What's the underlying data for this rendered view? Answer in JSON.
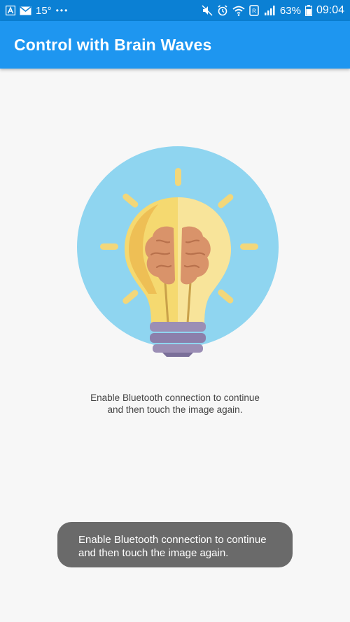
{
  "status_bar": {
    "temperature": "15°",
    "more": "•••",
    "battery": "63%",
    "time": "09:04",
    "left_icons": [
      "app-a-icon",
      "mail-icon"
    ],
    "right_icons": [
      "mute-icon",
      "alarm-icon",
      "wifi-icon",
      "data-saver-icon",
      "signal-icon",
      "battery-icon"
    ]
  },
  "app_bar": {
    "title": "Control with Brain Waves"
  },
  "hero": {
    "icon": "lightbulb-brain-icon",
    "colors": {
      "circle": "#8fd5f0",
      "bulb": "#f5d970",
      "base": "#9b8eb5",
      "brain": "#d9936a"
    }
  },
  "message": {
    "line1": "Enable Bluetooth connection to continue",
    "line2": "and then touch the image again."
  },
  "toast": {
    "line1": "Enable Bluetooth connection to continue",
    "line2": "and then touch the image again."
  }
}
